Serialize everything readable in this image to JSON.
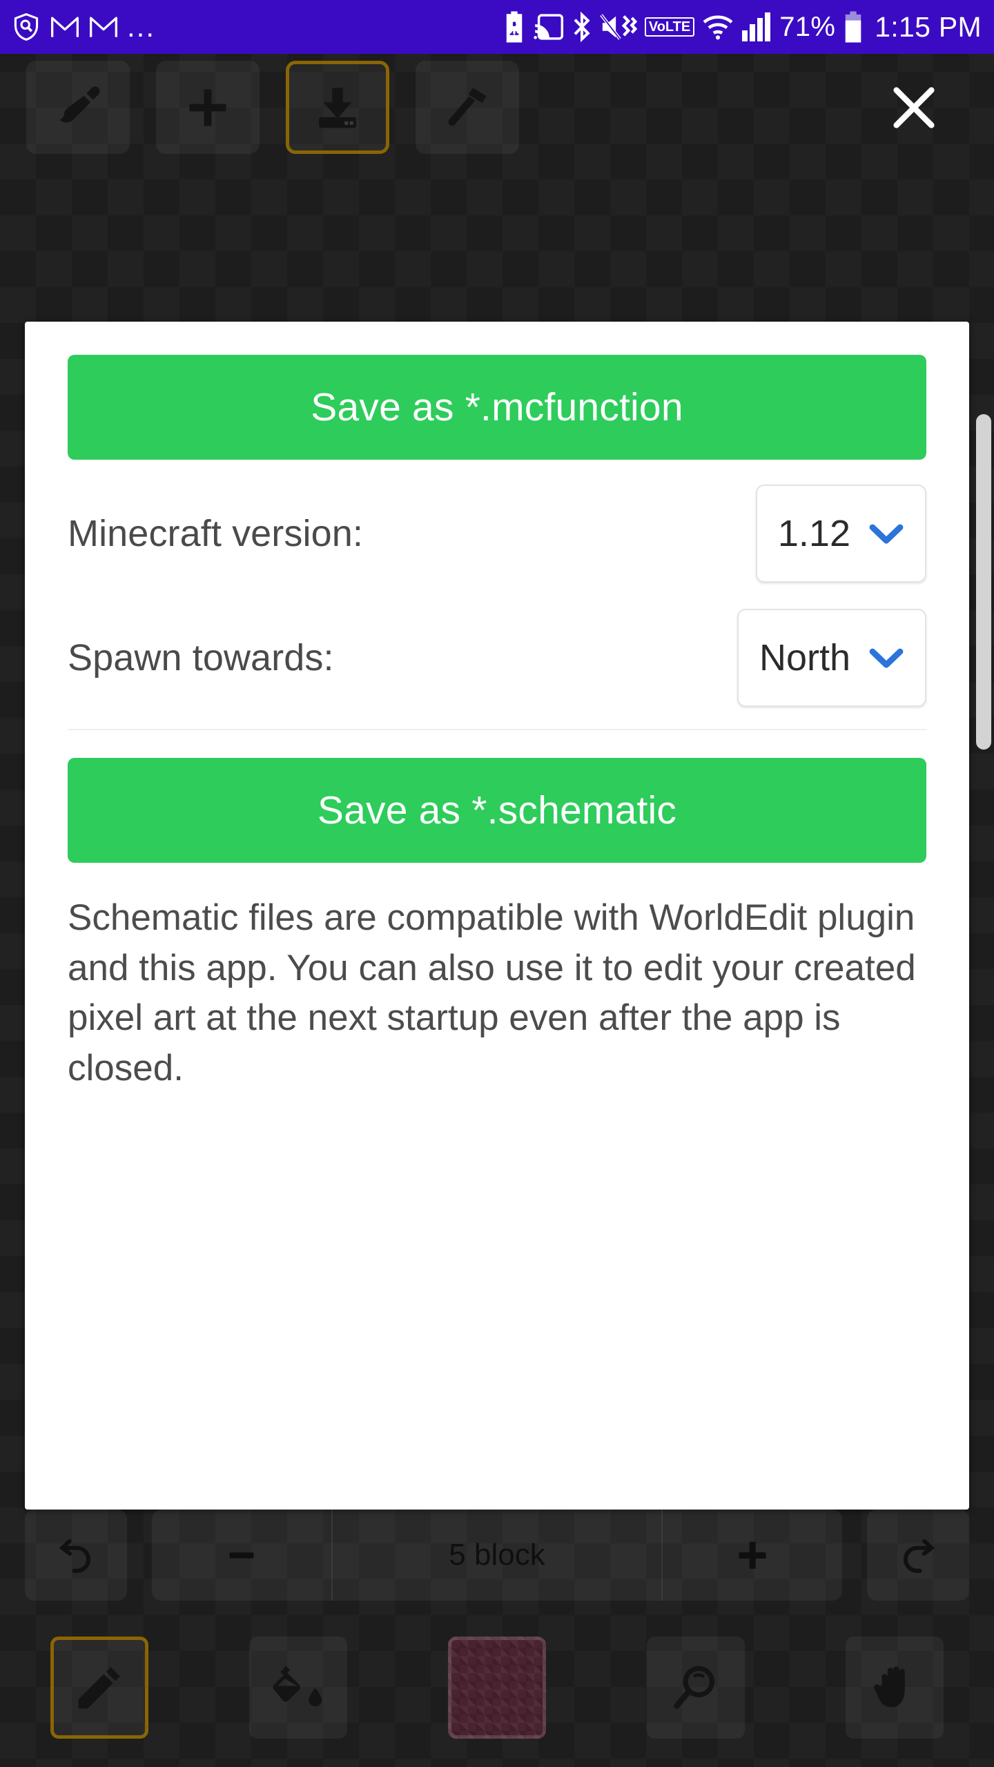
{
  "status_bar": {
    "background_color": "#3B0BC4",
    "left_icons": [
      {
        "name": "shield-search-icon"
      },
      {
        "name": "gmail-icon"
      },
      {
        "name": "gmail-icon"
      }
    ],
    "overflow_label": "...",
    "right_icons": [
      {
        "name": "battery-saver-icon"
      },
      {
        "name": "cast-icon"
      },
      {
        "name": "bluetooth-icon"
      },
      {
        "name": "mute-vibrate-icon"
      },
      {
        "name": "volte-icon"
      },
      {
        "name": "wifi-icon"
      },
      {
        "name": "signal-icon"
      }
    ],
    "volte_label": "VoLTE",
    "battery_percent": "71%",
    "time": "1:15 PM"
  },
  "top_toolbar": {
    "buttons": [
      {
        "name": "brush-tool-button",
        "icon": "paint-brush-icon",
        "selected": false
      },
      {
        "name": "add-layer-button",
        "icon": "plus-icon",
        "selected": false
      },
      {
        "name": "save-export-button",
        "icon": "download-icon",
        "selected": true
      },
      {
        "name": "build-tools-button",
        "icon": "hammer-icon",
        "selected": false
      }
    ],
    "close_label": "close-icon",
    "selected_border_color": "#8a6506"
  },
  "dialog": {
    "accent_green": "#2ECC5B",
    "save_mcfunction_label": "Save as *.mcfunction",
    "options": [
      {
        "label": "Minecraft version:",
        "value": "1.12",
        "name": "minecraft-version-select"
      },
      {
        "label": "Spawn towards:",
        "value": "North",
        "name": "spawn-direction-select"
      }
    ],
    "save_schematic_label": "Save as *.schematic",
    "description": "Schematic files are compatible with WorldEdit plugin and this app. You can also use it to edit your created pixel art at the next startup even after the app is closed.",
    "chevron_color": "#2a74da"
  },
  "size_bar": {
    "undo_icon": "undo-icon",
    "decrease_label": "−",
    "size_value": "5 block",
    "increase_label": "+",
    "redo_icon": "redo-icon"
  },
  "bottom_toolbar": {
    "tools": [
      {
        "name": "pencil-tool-button",
        "icon": "pencil-icon",
        "selected": true
      },
      {
        "name": "fill-tool-button",
        "icon": "paint-bucket-icon",
        "selected": false
      },
      {
        "name": "block-swatch-button",
        "icon": "block-swatch",
        "selected": false,
        "color": "#4a2330"
      },
      {
        "name": "zoom-tool-button",
        "icon": "magnifier-icon",
        "selected": false
      },
      {
        "name": "pan-tool-button",
        "icon": "hand-icon",
        "selected": false
      }
    ]
  }
}
